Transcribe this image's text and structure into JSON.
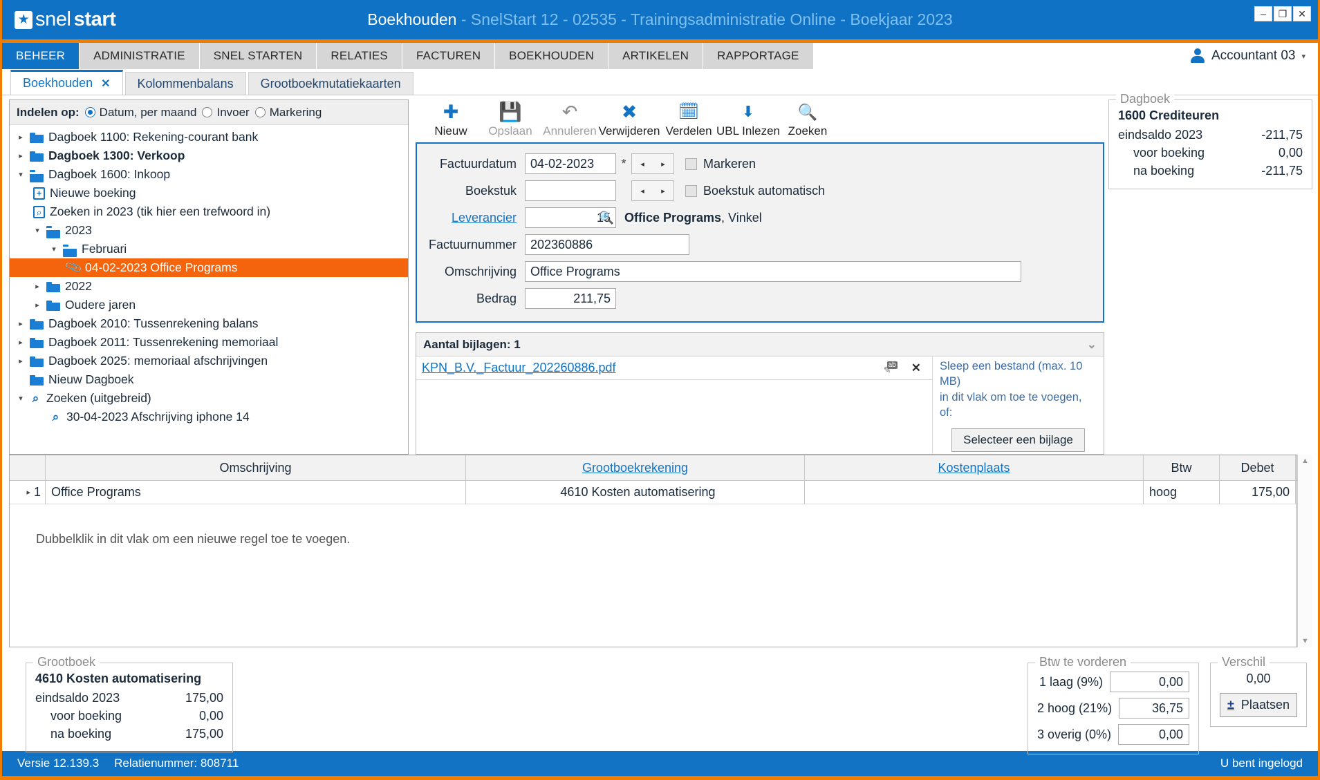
{
  "window": {
    "brand_first": "snel",
    "brand_second": "start",
    "logo_icon": "star-icon",
    "title_main": "Boekhouden",
    "title_sub": " - SnelStart 12 - 02535 - Trainingsadministratie Online - Boekjaar 2023",
    "minimize": "–",
    "restore": "❐",
    "close": "✕",
    "accent_blue": "#0f72c4",
    "accent_orange": "#f07d00",
    "selection_orange": "#f4640d"
  },
  "ribbon": {
    "tabs": [
      {
        "label": "BEHEER",
        "active": true
      },
      {
        "label": "ADMINISTRATIE",
        "active": false
      },
      {
        "label": "SNEL STARTEN",
        "active": false
      },
      {
        "label": "RELATIES",
        "active": false
      },
      {
        "label": "FACTUREN",
        "active": false
      },
      {
        "label": "BOEKHOUDEN",
        "active": false
      },
      {
        "label": "ARTIKELEN",
        "active": false
      },
      {
        "label": "RAPPORTAGE",
        "active": false
      }
    ],
    "account": "Accountant 03",
    "account_caret": "▾"
  },
  "doc_tabs": [
    {
      "label": "Boekhouden",
      "close": "✕",
      "active": true
    },
    {
      "label": "Kolommenbalans",
      "active": false
    },
    {
      "label": "Grootboekmutatiekaarten",
      "active": false
    }
  ],
  "tree_panel": {
    "indelen_label": "Indelen op:",
    "options": [
      {
        "label": "Datum, per maand",
        "selected": true
      },
      {
        "label": "Invoer",
        "selected": false
      },
      {
        "label": "Markering",
        "selected": false
      }
    ],
    "nodes": [
      {
        "label": "Dagboek 1100: Rekening-courant bank",
        "indent": 1,
        "icon": "folder-icon",
        "arrow": "▸",
        "bold": false,
        "selected": false
      },
      {
        "label": "Dagboek 1300: Verkoop",
        "indent": 1,
        "icon": "folder-icon",
        "arrow": "▸",
        "bold": true,
        "selected": false
      },
      {
        "label": "Dagboek 1600: Inkoop",
        "indent": 1,
        "icon": "folder-open-icon",
        "arrow": "▾",
        "bold": false,
        "selected": false
      },
      {
        "label": "Nieuwe boeking",
        "indent": 2,
        "icon": "new-entry-icon",
        "arrow": "",
        "bold": false,
        "selected": false
      },
      {
        "label": "Zoeken in 2023 (tik hier een trefwoord in)",
        "indent": 2,
        "icon": "search-box-icon",
        "arrow": "",
        "bold": false,
        "selected": false
      },
      {
        "label": "2023",
        "indent": 2,
        "icon": "folder-open-icon",
        "arrow": "▾",
        "bold": false,
        "selected": false
      },
      {
        "label": "Februari",
        "indent": 3,
        "icon": "folder-open-icon",
        "arrow": "▾",
        "bold": false,
        "selected": false
      },
      {
        "label": "04-02-2023 Office Programs",
        "indent": 4,
        "icon": "paperclip-icon",
        "arrow": "",
        "bold": false,
        "selected": true
      },
      {
        "label": "2022",
        "indent": 2,
        "icon": "folder-icon",
        "arrow": "▸",
        "bold": false,
        "selected": false
      },
      {
        "label": "Oudere jaren",
        "indent": 2,
        "icon": "folder-icon",
        "arrow": "▸",
        "bold": false,
        "selected": false
      },
      {
        "label": "Dagboek 2010: Tussenrekening balans",
        "indent": 1,
        "icon": "folder-icon",
        "arrow": "▸",
        "bold": false,
        "selected": false
      },
      {
        "label": "Dagboek 2011: Tussenrekening memoriaal",
        "indent": 1,
        "icon": "folder-icon",
        "arrow": "▸",
        "bold": false,
        "selected": false
      },
      {
        "label": "Dagboek 2025: memoriaal afschrijvingen",
        "indent": 1,
        "icon": "folder-icon",
        "arrow": "▸",
        "bold": false,
        "selected": false
      },
      {
        "label": "Nieuw Dagboek",
        "indent": 1,
        "icon": "folder-icon",
        "arrow": "",
        "bold": false,
        "selected": false
      },
      {
        "label": "Zoeken (uitgebreid)",
        "indent": 1,
        "icon": "magnifier-icon",
        "arrow": "▾",
        "bold": false,
        "selected": false
      },
      {
        "label": "30-04-2023 Afschrijving iphone 14",
        "indent": 2,
        "icon": "magnifier-icon",
        "arrow": "",
        "bold": false,
        "selected": false
      }
    ]
  },
  "toolbar": [
    {
      "label": "Nieuw",
      "icon": "plus-icon",
      "glyph": "✚",
      "color": "#1273c5",
      "disabled": false
    },
    {
      "label": "Opslaan",
      "icon": "save-icon",
      "glyph": "💾",
      "color": "#8a8a8a",
      "disabled": true
    },
    {
      "label": "Annuleren",
      "icon": "undo-icon",
      "glyph": "↶",
      "color": "#8a8a8a",
      "disabled": true
    },
    {
      "label": "Verwijderen",
      "icon": "delete-circle-icon",
      "glyph": "✖",
      "color": "#1273c5",
      "disabled": false
    },
    {
      "label": "Verdelen",
      "icon": "calendar-icon",
      "glyph": "📅",
      "color": "#1273c5",
      "disabled": false
    },
    {
      "label": "UBL Inlezen",
      "icon": "file-download-icon",
      "glyph": "⬇",
      "color": "#1273c5",
      "disabled": false
    },
    {
      "label": "Zoeken",
      "icon": "magnifier-icon",
      "glyph": "🔍",
      "color": "#1273c5",
      "disabled": false
    }
  ],
  "form": {
    "factuurdatum_label": "Factuurdatum",
    "factuurdatum_value": "04-02-2023",
    "required_marker": "*",
    "markeren_label": "Markeren",
    "boekstuk_label": "Boekstuk",
    "boekstuk_value": "",
    "boekstuk_auto_label": "Boekstuk automatisch",
    "leverancier_label": "Leverancier",
    "leverancier_value": "15",
    "leverancier_name": "Office Programs",
    "leverancier_city": ", Vinkel",
    "factuurnummer_label": "Factuurnummer",
    "factuurnummer_value": "202360886",
    "omschrijving_label": "Omschrijving",
    "omschrijving_value": "Office Programs",
    "bedrag_label": "Bedrag",
    "bedrag_value": "211,75",
    "spin_prev": "◂",
    "spin_next": "▸",
    "search_glyph": "🔍"
  },
  "attachments": {
    "header": "Aantal bijlagen: 1",
    "collapse_icon": "chevron-down-icon",
    "collapse_glyph": "⌄",
    "files": [
      {
        "name": "KPN_B.V._Factuur_202260886.pdf",
        "rename_icon": "rename-icon",
        "delete_icon": "close-icon",
        "delete_glyph": "✕"
      }
    ],
    "drop_line1": "Sleep een bestand (max. 10 MB)",
    "drop_line2": "in dit vlak om toe te voegen, of:",
    "select_button": "Selecteer een bijlage"
  },
  "dagboek_panel": {
    "group_title": "Dagboek",
    "account": "1600 Crediteuren",
    "rows": [
      {
        "label": "eindsaldo 2023",
        "value": "-211,75",
        "indent": false
      },
      {
        "label": "voor boeking",
        "value": "0,00",
        "indent": true
      },
      {
        "label": "na boeking",
        "value": "-211,75",
        "indent": true
      }
    ]
  },
  "grid": {
    "columns": [
      "Omschrijving",
      "Grootboekrekening",
      "Kostenplaats",
      "Btw",
      "Debet"
    ],
    "column_links": [
      false,
      true,
      true,
      false,
      false
    ],
    "rows": [
      {
        "num": "1",
        "expander": "▸",
        "omschrijving": "Office Programs",
        "grootboekrekening": "4610 Kosten automatisering",
        "kostenplaats": "",
        "btw": "hoog",
        "debet": "175,00"
      }
    ],
    "hint": "Dubbelklik in dit vlak om een nieuwe regel toe te voegen.",
    "scroll_up": "▲",
    "scroll_down": "▼"
  },
  "grootboek_panel": {
    "group_title": "Grootboek",
    "account": "4610 Kosten automatisering",
    "rows": [
      {
        "label": "eindsaldo 2023",
        "value": "175,00",
        "indent": false
      },
      {
        "label": "voor boeking",
        "value": "0,00",
        "indent": true
      },
      {
        "label": "na boeking",
        "value": "175,00",
        "indent": true
      }
    ]
  },
  "btw_panel": {
    "group_title": "Btw te vorderen",
    "rows": [
      {
        "label": "1 laag (9%)",
        "value": "0,00"
      },
      {
        "label": "2 hoog (21%)",
        "value": "36,75"
      },
      {
        "label": "3 overig (0%)",
        "value": "0,00"
      }
    ]
  },
  "verschil_panel": {
    "group_title": "Verschil",
    "value": "0,00",
    "button_label": "Plaatsen",
    "button_sign": "±"
  },
  "status_bar": {
    "version": "Versie 12.139.3",
    "relation": "Relatienummer: 808711",
    "login_state": "U bent ingelogd"
  }
}
